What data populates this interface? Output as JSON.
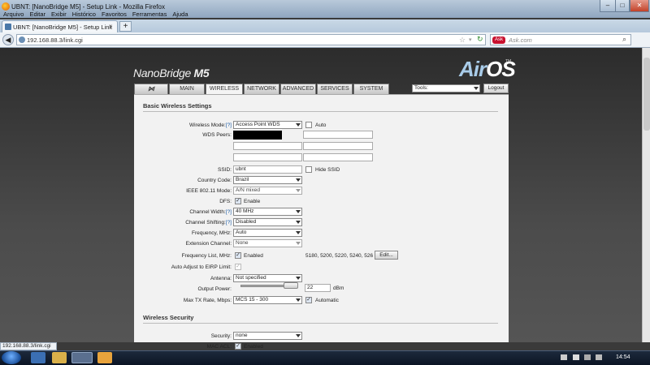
{
  "window": {
    "title": "UBNT: [NanoBridge M5] - Setup Link - Mozilla Firefox",
    "buttons": [
      "–",
      "□",
      "✕"
    ]
  },
  "menu": [
    "Arquivo",
    "Editar",
    "Exibir",
    "Histórico",
    "Favoritos",
    "Ferramentas",
    "Ajuda"
  ],
  "tab": {
    "label": "UBNT: [NanoBridge M5] - Setup Link",
    "new": "+"
  },
  "nav": {
    "back": "◀",
    "url": "192.168.88.3/link.cgi",
    "search_placeholder": "Ask.com",
    "search_engine": "Ask"
  },
  "brand": {
    "device": "NanoBridge",
    "model": "M5",
    "logo_air": "Air",
    "logo_os": "OS",
    "tm": "TM"
  },
  "tabs": [
    "MAIN",
    "WIRELESS",
    "NETWORK",
    "ADVANCED",
    "SERVICES",
    "SYSTEM"
  ],
  "tools": {
    "label": "Tools:",
    "logout": "Logout"
  },
  "basic": {
    "heading": "Basic Wireless Settings",
    "wireless_mode": {
      "label": "Wireless Mode:",
      "help": "[?]",
      "value": "Access Point WDS",
      "auto": "Auto"
    },
    "wds_peers": {
      "label": "WDS Peers:"
    },
    "ssid": {
      "label": "SSID:",
      "value": "ubnt",
      "hide": "Hide SSID"
    },
    "country": {
      "label": "Country Code:",
      "value": "Brazil"
    },
    "ieee": {
      "label": "IEEE 802.11 Mode:",
      "value": "A/N mixed"
    },
    "dfs": {
      "label": "DFS:",
      "value": "Enable"
    },
    "channel_width": {
      "label": "Channel Width:",
      "help": "[?]",
      "value": "40 MHz"
    },
    "channel_shifting": {
      "label": "Channel Shifting:",
      "help": "[?]",
      "value": "Disabled"
    },
    "frequency": {
      "label": "Frequency, MHz:",
      "value": "Auto"
    },
    "extension": {
      "label": "Extension Channel:",
      "value": "None"
    },
    "freq_list": {
      "label": "Frequency List, MHz:",
      "enabled": "Enabled",
      "list": "5180, 5200, 5220, 5240, 526",
      "edit": "Edit..."
    },
    "eirp": {
      "label": "Auto Adjust to EIRP Limit:"
    },
    "antenna": {
      "label": "Antenna:",
      "value": "Not specified"
    },
    "output_power": {
      "label": "Output Power:",
      "value": "22",
      "unit": "dBm"
    },
    "max_tx": {
      "label": "Max TX Rate, Mbps:",
      "value": "MCS 15 - 300",
      "auto": "Automatic"
    }
  },
  "security": {
    "heading": "Wireless Security",
    "security": {
      "label": "Security:",
      "value": "none"
    },
    "mac_acl": {
      "label": "MAC ACL:",
      "value": "Enabled"
    }
  },
  "status_text": "192.168.88.3/link.cgi",
  "clock": "14:54",
  "colors": {
    "page_bg": "#3a3a3a",
    "panel_bg": "#f2f2f2",
    "logo_blue": "#a9cce9",
    "help_link": "#1f5fa8"
  }
}
